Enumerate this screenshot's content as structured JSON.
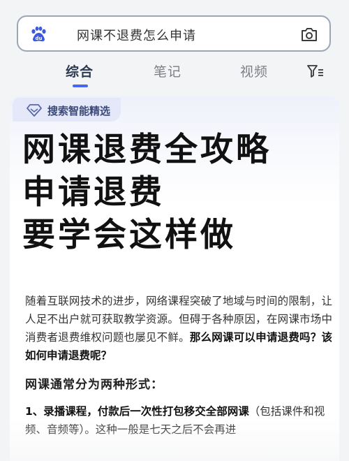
{
  "search": {
    "query": "网课不退费怎么申请"
  },
  "tabs": [
    {
      "label": "综合"
    },
    {
      "label": "笔记"
    },
    {
      "label": "视频"
    }
  ],
  "ai_section": {
    "label": "搜索智能精选"
  },
  "hero": {
    "line1": "网课退费全攻略",
    "line2": "申请退费",
    "line3": "要学会这样做"
  },
  "body": {
    "paragraph_plain": "随着互联网技术的进步，网络课程突破了地域与时间的限制，让人足不出户就可获取教学资源。但碍于各种原因，在网课市场中消费者退费维权问题也屡见不鲜。",
    "paragraph_bold": "那么网课可以申请退费吗？该如何申请退费呢？",
    "section_title": "网课通常分为两种形式：",
    "point1_bold": "1、录播课程，付款后一次性打包移交全部网课",
    "point1_plain": "（包括课件和视频、音频等）。这种一般是七天之后不会再进"
  },
  "colors": {
    "accent": "#4a66f0",
    "tab_active": "#2d3a52",
    "tab_inactive": "#7d7f85"
  },
  "icons": {
    "logo": "baidu-paw-icon",
    "camera": "camera-icon",
    "filter": "filter-icon",
    "ai": "diamond-icon"
  }
}
